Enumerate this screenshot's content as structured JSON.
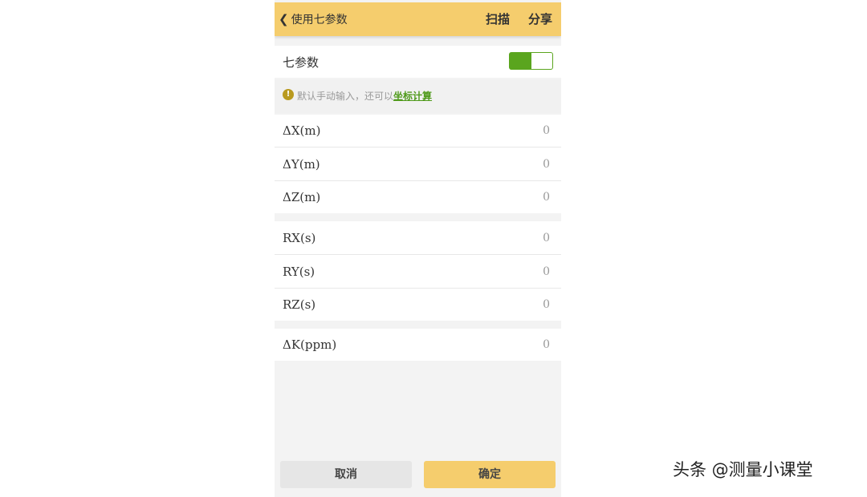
{
  "header": {
    "back_label": "使用七参数",
    "scan_label": "扫描",
    "share_label": "分享"
  },
  "seven_param": {
    "label": "七参数",
    "enabled": true
  },
  "hint": {
    "text": "默认手动输入，还可以",
    "link": "坐标计算"
  },
  "translations": [
    {
      "label": "ΔX(m)",
      "value": "0"
    },
    {
      "label": "ΔY(m)",
      "value": "0"
    },
    {
      "label": "ΔZ(m)",
      "value": "0"
    }
  ],
  "rotations": [
    {
      "label": "RX(s)",
      "value": "0"
    },
    {
      "label": "RY(s)",
      "value": "0"
    },
    {
      "label": "RZ(s)",
      "value": "0"
    }
  ],
  "scale": {
    "label": "ΔK(ppm)",
    "value": "0"
  },
  "footer": {
    "cancel_label": "取消",
    "confirm_label": "确定"
  },
  "watermark": "头条 @测量小课堂",
  "colors": {
    "header_bg": "#f5cd6d",
    "toggle_on": "#5aa51e",
    "link": "#4f9a1b"
  }
}
